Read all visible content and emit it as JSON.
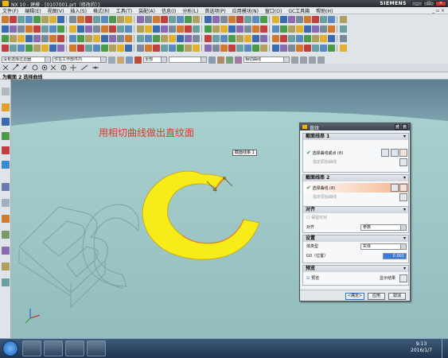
{
  "window": {
    "title": "NX 10 - 建模 - [0107001.prt（修改的）]",
    "brand": "SIEMENS",
    "minimize": "_",
    "maximize": "□",
    "close": "×"
  },
  "menu": {
    "items": [
      "文件(F)",
      "编辑(E)",
      "视图(V)",
      "插入(S)",
      "格式(R)",
      "工具(T)",
      "装配(A)",
      "信息(I)",
      "分析(L)",
      "首选项(P)",
      "应用模块(N)",
      "窗口(O)",
      "GC工具箱",
      "帮助(H)"
    ],
    "right_controls": "_ ▫ ×"
  },
  "filter_bar": {
    "type_filter": "没有选择过滤器",
    "scope_filter": "仅在工作部件内",
    "selection_intent": "全部",
    "curve_rule": "相切曲线"
  },
  "cue_line": "为截面 2 选择曲线",
  "viewport": {
    "annotation": "用相切曲线做出直纹面",
    "tooltip": "截面线串 1",
    "ghost_text": "BC",
    "c_color": "#f5ec1a"
  },
  "dialog": {
    "title": "直纹",
    "close_btn": "×",
    "reset_btn": "↺",
    "section1": {
      "header": "截面线串 1",
      "select_label": "选择曲线或点 (8)",
      "specify_origin": "指定原始曲线"
    },
    "section2": {
      "header": "截面线串 2",
      "select_label": "选择曲线 (8)",
      "specify_origin": "指定原始曲线"
    },
    "alignment": {
      "header": "对齐",
      "preserve_label": "保留形状",
      "align_label": "对齐",
      "align_value": "参数"
    },
    "settings": {
      "header": "设置",
      "body_type_label": "体类型",
      "body_type_value": "实体",
      "g0_label": "G0（位置）",
      "g0_value": "0.001"
    },
    "preview": {
      "header": "预览",
      "preview_label": "预览",
      "show_result": "显示结果"
    },
    "buttons": {
      "ok": "<确定>",
      "apply": "应用",
      "cancel": "取消"
    }
  },
  "taskbar": {
    "time": "9:13",
    "date": "2016/1/7"
  }
}
